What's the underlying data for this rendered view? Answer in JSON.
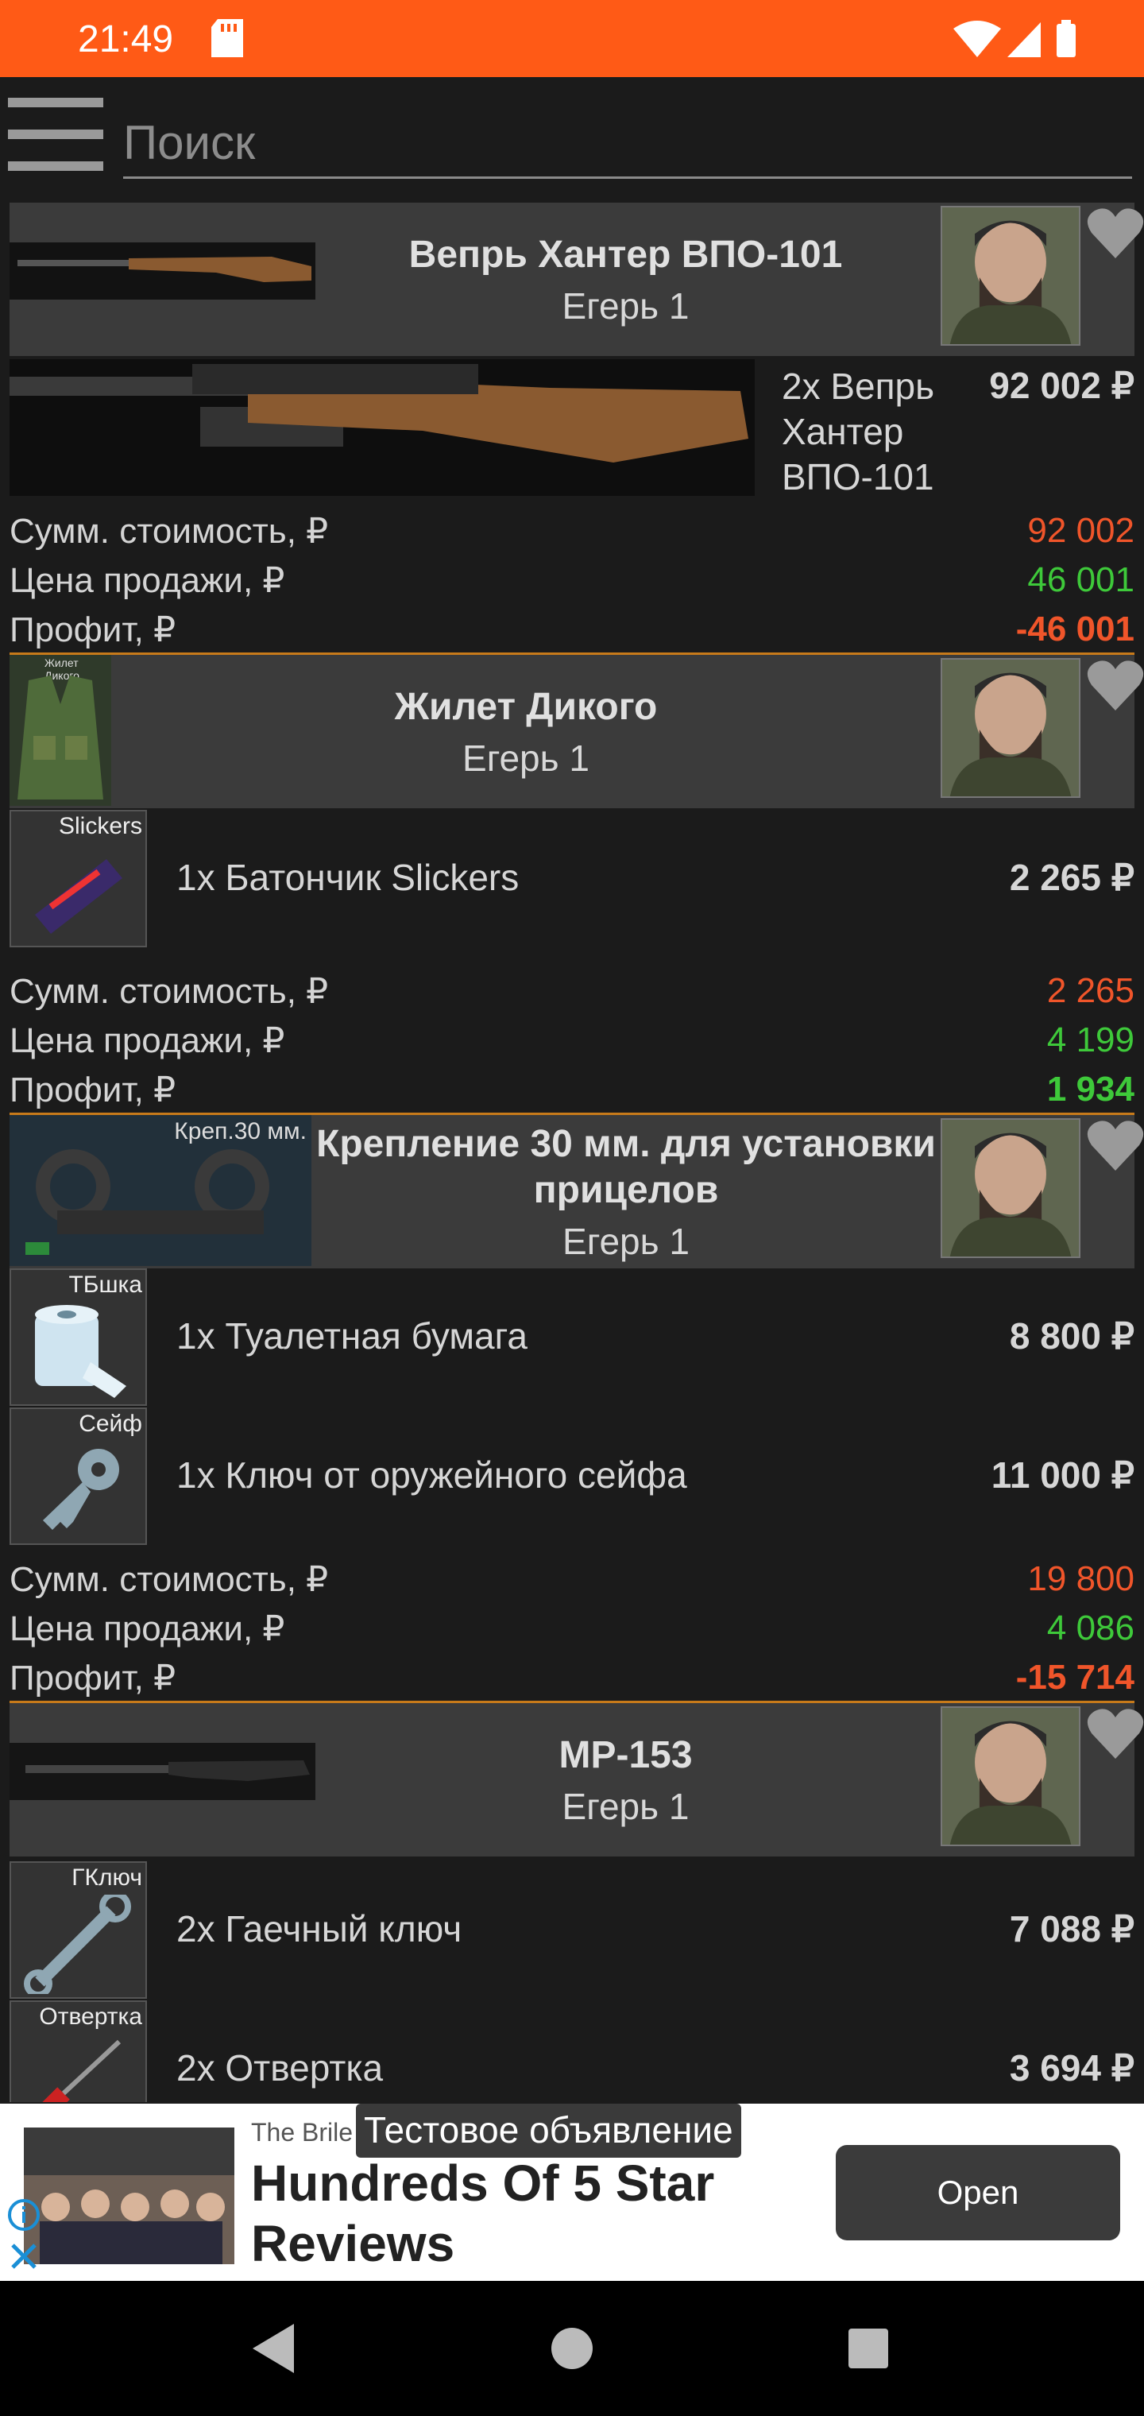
{
  "status": {
    "time": "21:49"
  },
  "search": {
    "placeholder": "Поиск"
  },
  "cards": [
    {
      "title": "Вепрь Хантер ВПО-101",
      "trader": "Егерь 1",
      "requirements": [
        {
          "text": "2x Вепрь Хантер ВПО-101",
          "price": "92 002 ₽"
        }
      ],
      "stats": [
        {
          "label": "Сумм. стоимость, ₽",
          "value": "92 002"
        },
        {
          "label": "Цена продажи, ₽",
          "value": "46 001"
        },
        {
          "label": "Профит, ₽",
          "value": "-46 001"
        }
      ]
    },
    {
      "title": "Жилет Дикого",
      "trader": "Егерь 1",
      "thumb_label": "Жилет Дикого",
      "requirements": [
        {
          "icon_label": "Slickers",
          "text": "1x Батончик Slickers",
          "price": "2 265 ₽"
        }
      ],
      "stats": [
        {
          "label": "Сумм. стоимость, ₽",
          "value": "2 265"
        },
        {
          "label": "Цена продажи, ₽",
          "value": "4 199"
        },
        {
          "label": "Профит, ₽",
          "value": "1 934"
        }
      ]
    },
    {
      "title": "Крепление 30 мм. для установки прицелов",
      "trader": "Егерь 1",
      "thumb_label": "Креп.30 мм.",
      "requirements": [
        {
          "icon_label": "ТБшка",
          "text": "1x Туалетная бумага",
          "price": "8 800 ₽"
        },
        {
          "icon_label": "Сейф",
          "text": "1x Ключ от оружейного сейфа",
          "price": "11 000 ₽"
        }
      ],
      "stats": [
        {
          "label": "Сумм. стоимость, ₽",
          "value": "19 800"
        },
        {
          "label": "Цена продажи, ₽",
          "value": "4 086"
        },
        {
          "label": "Профит, ₽",
          "value": "-15 714"
        }
      ]
    },
    {
      "title": "MP-153",
      "trader": "Егерь 1",
      "requirements": [
        {
          "icon_label": "ГКлюч",
          "text": "2x Гаечный ключ",
          "price": "7 088 ₽"
        },
        {
          "icon_label": "Отвертка",
          "text": "2x Отвертка",
          "price": "3 694 ₽"
        }
      ]
    }
  ],
  "ad": {
    "brand": "The Brile",
    "test_label": "Тестовое объявление",
    "headline": "Hundreds Of 5 Star Reviews",
    "open_label": "Open"
  },
  "colors": {
    "statusbar": "#ff5a16",
    "negative": "#f0552a",
    "positive": "#3ec93a",
    "divider": "#c77a1a"
  }
}
